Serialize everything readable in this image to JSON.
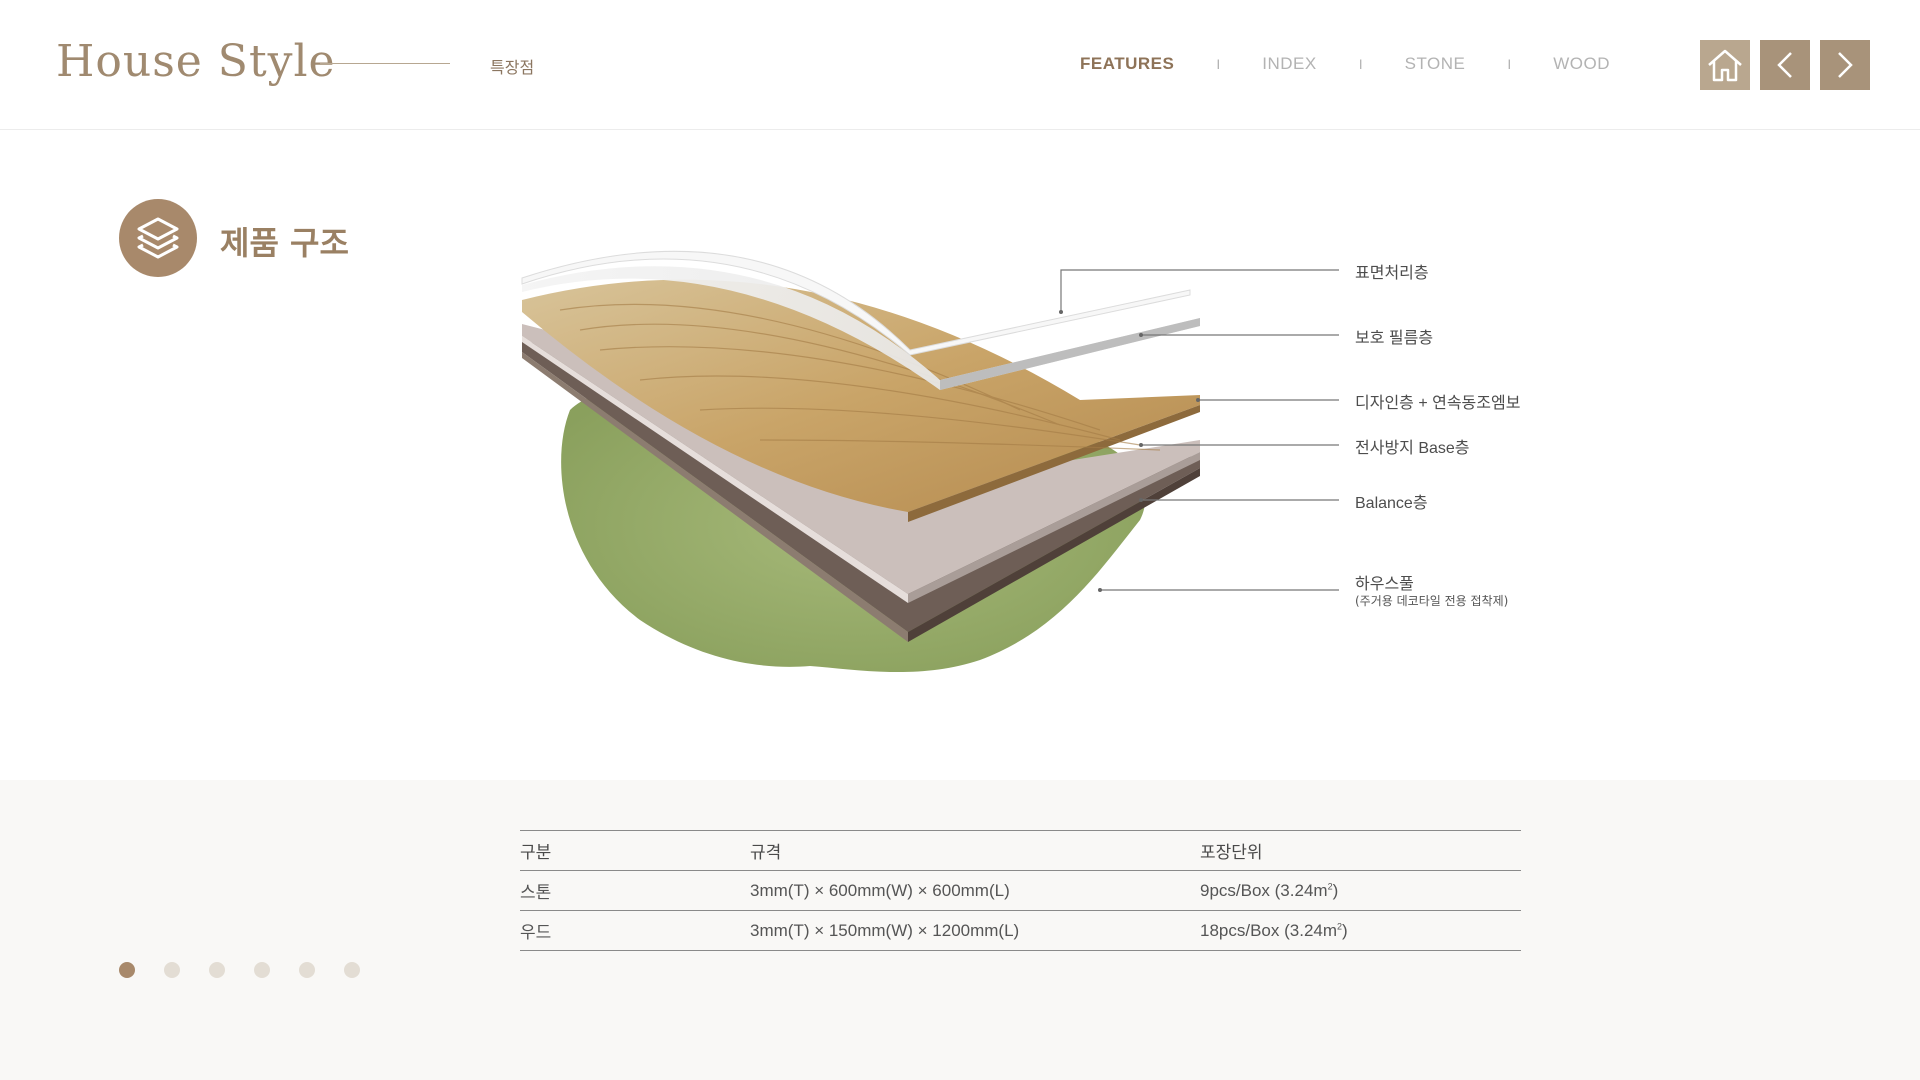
{
  "header": {
    "logo": "House Style",
    "subtitle": "특장점",
    "nav": [
      {
        "label": "FEATURES",
        "active": true
      },
      {
        "label": "INDEX",
        "active": false
      },
      {
        "label": "STONE",
        "active": false
      },
      {
        "label": "WOOD",
        "active": false
      }
    ],
    "separator": "I",
    "buttons": {
      "home": "home-icon",
      "prev": "chevron-left-icon",
      "next": "chevron-right-icon"
    }
  },
  "section": {
    "title": "제품 구조",
    "icon": "layers-icon"
  },
  "diagram": {
    "layers": [
      {
        "label": "표면처리층",
        "sub": ""
      },
      {
        "label": "보호 필름층",
        "sub": ""
      },
      {
        "label": "디자인층 + 연속동조엠보",
        "sub": ""
      },
      {
        "label": "전사방지 Base층",
        "sub": ""
      },
      {
        "label": "Balance층",
        "sub": ""
      },
      {
        "label": "하우스풀",
        "sub": "(주거용 데코타일 전용 접착제)"
      }
    ]
  },
  "table": {
    "headers": [
      "구분",
      "규격",
      "포장단위"
    ],
    "rows": [
      {
        "type": "스톤",
        "size": "3mm(T) × 600mm(W) × 600mm(L)",
        "pack": "9pcs/Box (3.24m",
        "pack_sup": "2",
        "pack_end": ")"
      },
      {
        "type": "우드",
        "size": "3mm(T) × 150mm(W) × 1200mm(L)",
        "pack": "18pcs/Box (3.24m",
        "pack_sup": "2",
        "pack_end": ")"
      }
    ]
  },
  "pagination": {
    "total": 6,
    "active": 1
  },
  "colors": {
    "brand": "#a8896b",
    "brand_light": "#b9a78f",
    "text": "#555555",
    "adhesive_green": "#9aae6e",
    "wood": "#c9a468"
  }
}
